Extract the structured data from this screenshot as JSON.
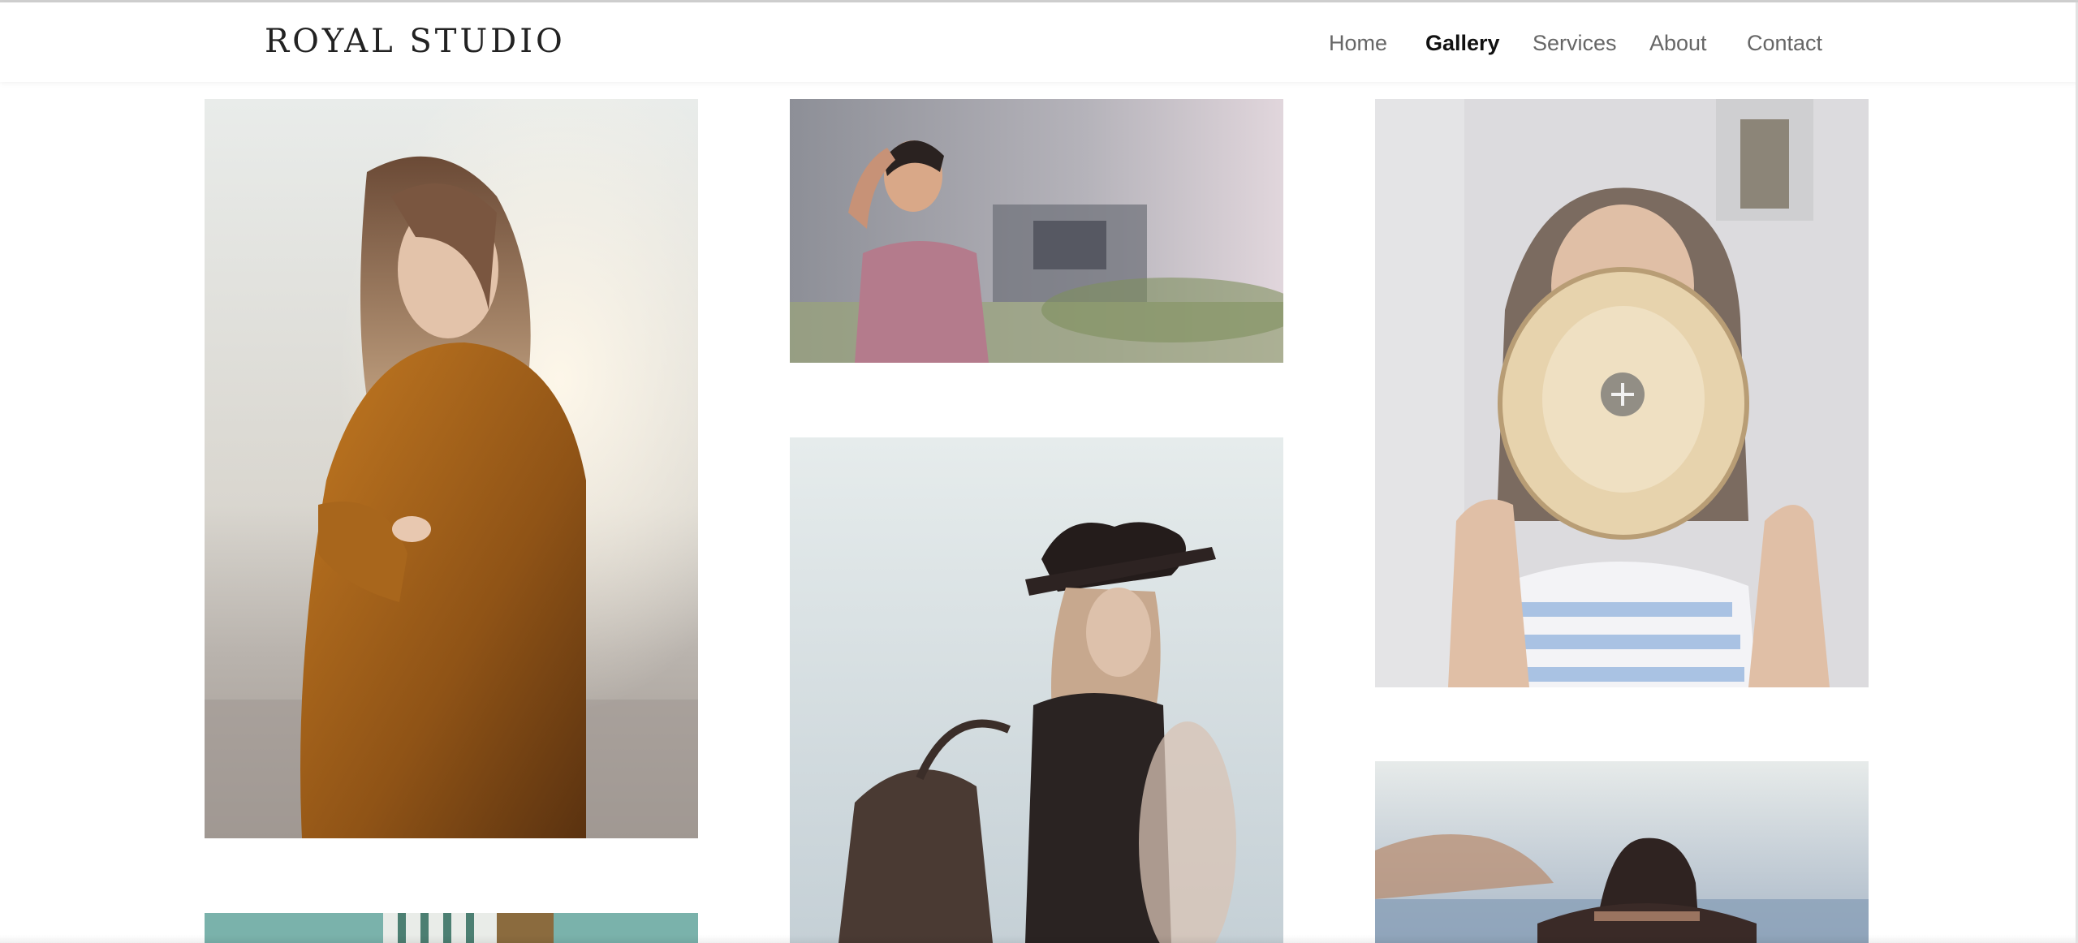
{
  "brand": {
    "logo_text": "ROYAL STUDIO"
  },
  "nav": {
    "items": [
      {
        "label": "Home"
      },
      {
        "label": "Gallery"
      },
      {
        "label": "Services"
      },
      {
        "label": "About"
      },
      {
        "label": "Contact"
      }
    ],
    "active": "Gallery"
  },
  "gallery": {
    "photos": [
      {
        "subject": "woman in mustard knit sweater at seaside sunset"
      },
      {
        "subject": "man in pink shirt near building"
      },
      {
        "subject": "woman covering face with straw hat"
      },
      {
        "subject": "woman in black hat with backpack"
      },
      {
        "subject": "person in brown hat by the sea"
      },
      {
        "subject": "person in striped top against teal wall"
      }
    ],
    "zoom_icon": "plus-icon"
  },
  "colors": {
    "nav_text": "#666666",
    "nav_active": "#111111",
    "background": "#ffffff"
  }
}
